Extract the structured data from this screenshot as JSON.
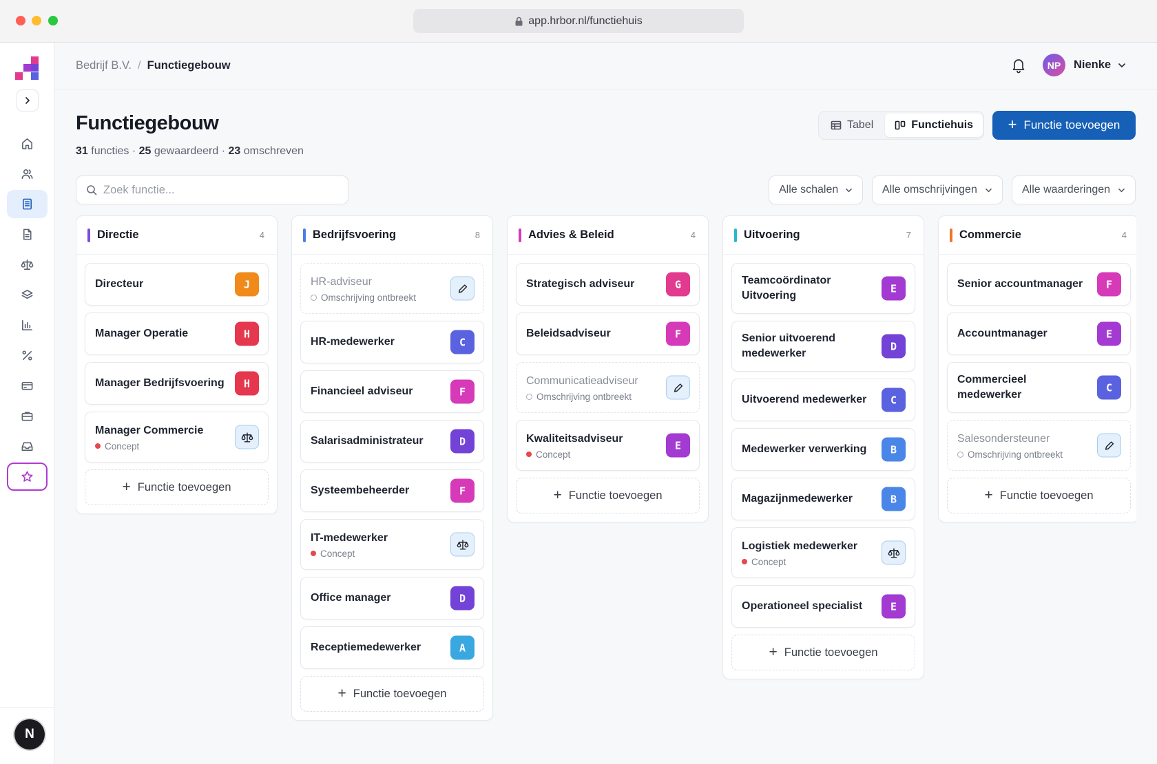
{
  "browser": {
    "url": "app.hrbor.nl/functiehuis"
  },
  "topbar": {
    "breadcrumb_parent": "Bedrijf B.V.",
    "breadcrumb_separator": "/",
    "breadcrumb_current": "Functiegebouw",
    "user_initials": "NP",
    "user_name": "Nienke"
  },
  "sidebar": {
    "items": [
      {
        "icon": "home-icon"
      },
      {
        "icon": "users-icon"
      },
      {
        "icon": "list-document-icon",
        "active": true
      },
      {
        "icon": "file-icon"
      },
      {
        "icon": "scale-icon"
      },
      {
        "icon": "layers-icon"
      },
      {
        "icon": "bar-chart-icon"
      },
      {
        "icon": "percent-icon"
      },
      {
        "icon": "credit-card-icon"
      },
      {
        "icon": "briefcase-icon"
      },
      {
        "icon": "inbox-icon"
      },
      {
        "icon": "star-icon"
      }
    ],
    "footer_avatar": "N"
  },
  "header": {
    "title": "Functiegebouw",
    "stats": {
      "functies": "31",
      "functies_label": "functies",
      "gewaardeerd": "25",
      "gewaardeerd_label": "gewaardeerd",
      "omschreven": "23",
      "omschreven_label": "omschreven",
      "sep": "·"
    },
    "view_toggle": {
      "table_label": "Tabel",
      "house_label": "Functiehuis",
      "selected": "Functiehuis"
    },
    "add_button": "Functie toevoegen",
    "search_placeholder": "Zoek functie...",
    "filters": [
      "Alle schalen",
      "Alle omschrijvingen",
      "Alle waarderingen"
    ]
  },
  "colors": {
    "primary": "#1660b8",
    "badge_A": "#3aa8e0",
    "badge_B": "#4a86e8",
    "badge_C": "#5a62e0",
    "badge_D": "#7243d6",
    "badge_E": "#a33ad2",
    "badge_F": "#d63ab8",
    "badge_G": "#e23a8e",
    "badge_H": "#e5374d",
    "badge_J": "#f08a1a"
  },
  "board": {
    "add_label": "Functie toevoegen",
    "columns": [
      {
        "title": "Directie",
        "count": "4",
        "color": "#7c4ddb",
        "cards": [
          {
            "name": "Directeur",
            "badge": "J"
          },
          {
            "name": "Manager Operatie",
            "badge": "H"
          },
          {
            "name": "Manager Bedrijfsvoering",
            "badge": "H"
          },
          {
            "name": "Manager Commercie",
            "status": "Concept",
            "icon": "scale-icon"
          }
        ]
      },
      {
        "title": "Bedrijfsvoering",
        "count": "8",
        "color": "#4a7de8",
        "cards": [
          {
            "name": "HR-adviseur",
            "status": "Omschrijving ontbreekt",
            "icon": "pencil-icon",
            "missing": true
          },
          {
            "name": "HR-medewerker",
            "badge": "C"
          },
          {
            "name": "Financieel adviseur",
            "badge": "F"
          },
          {
            "name": "Salarisadministrateur",
            "badge": "D"
          },
          {
            "name": "Systeembeheerder",
            "badge": "F"
          },
          {
            "name": "IT-medewerker",
            "status": "Concept",
            "icon": "scale-icon"
          },
          {
            "name": "Office manager",
            "badge": "D"
          },
          {
            "name": "Receptiemedewerker",
            "badge": "A"
          }
        ]
      },
      {
        "title": "Advies & Beleid",
        "count": "4",
        "color": "#d63ab8",
        "cards": [
          {
            "name": "Strategisch adviseur",
            "badge": "G"
          },
          {
            "name": "Beleidsadviseur",
            "badge": "F"
          },
          {
            "name": "Communicatieadviseur",
            "status": "Omschrijving ontbreekt",
            "icon": "pencil-icon",
            "missing": true
          },
          {
            "name": "Kwaliteitsadviseur",
            "status": "Concept",
            "badge": "E"
          }
        ]
      },
      {
        "title": "Uitvoering",
        "count": "7",
        "color": "#2bb8c8",
        "cards": [
          {
            "name": "Teamcoördinator Uitvoering",
            "badge": "E"
          },
          {
            "name": "Senior uitvoerend medewerker",
            "badge": "D"
          },
          {
            "name": "Uitvoerend medewerker",
            "badge": "C"
          },
          {
            "name": "Medewerker verwerking",
            "badge": "B"
          },
          {
            "name": "Magazijnmedewerker",
            "badge": "B"
          },
          {
            "name": "Logistiek medewerker",
            "status": "Concept",
            "icon": "scale-icon"
          },
          {
            "name": "Operationeel specialist",
            "badge": "E"
          }
        ]
      },
      {
        "title": "Commercie",
        "count": "4",
        "color": "#f0742a",
        "cards": [
          {
            "name": "Senior accountmanager",
            "badge": "F"
          },
          {
            "name": "Accountmanager",
            "badge": "E"
          },
          {
            "name": "Commercieel medewerker",
            "badge": "C"
          },
          {
            "name": "Salesondersteuner",
            "status": "Omschrijving ontbreekt",
            "icon": "pencil-icon",
            "missing": true
          }
        ]
      }
    ]
  }
}
